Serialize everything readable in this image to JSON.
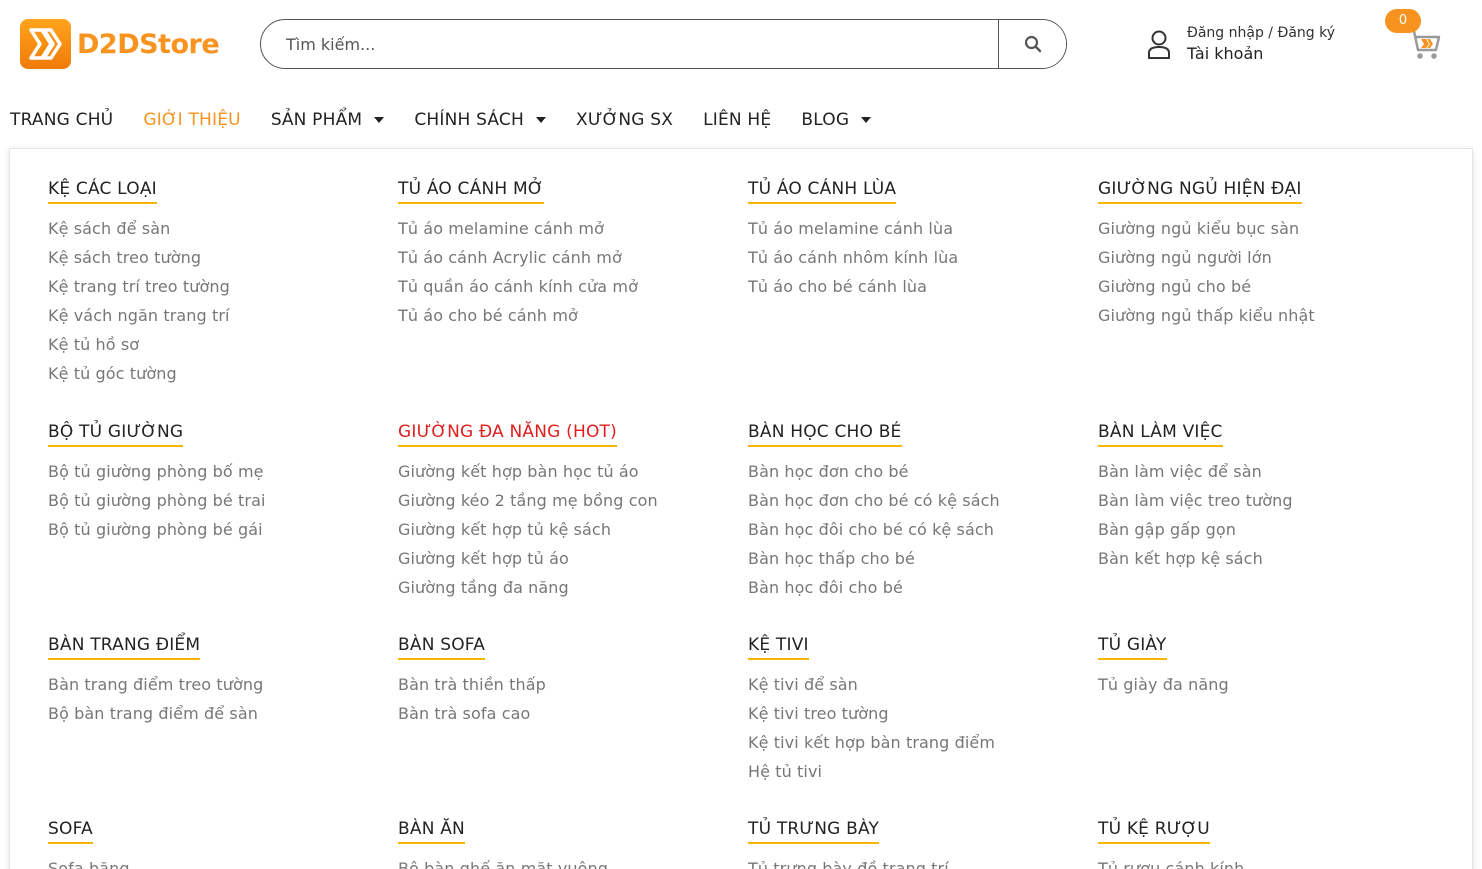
{
  "header": {
    "logo_text": "D2DStore",
    "search_placeholder": "Tìm kiếm...",
    "account_line1": "Đăng nhập / Đăng ký",
    "account_line2": "Tài khoản",
    "cart_count": "0"
  },
  "nav": {
    "items": [
      {
        "label": "TRANG CHỦ",
        "dropdown": false,
        "active": false
      },
      {
        "label": "GIỚI THIỆU",
        "dropdown": false,
        "active": true
      },
      {
        "label": "SẢN PHẨM",
        "dropdown": true,
        "active": false
      },
      {
        "label": "CHÍNH SÁCH",
        "dropdown": true,
        "active": false
      },
      {
        "label": "XƯỞNG SX",
        "dropdown": false,
        "active": false
      },
      {
        "label": "LIÊN HỆ",
        "dropdown": false,
        "active": false
      },
      {
        "label": "BLOG",
        "dropdown": true,
        "active": false
      }
    ]
  },
  "colors": {
    "brand": "#f7931e",
    "underline": "#f7b500",
    "hot": "#e01e1e",
    "link": "#777777"
  },
  "mega_menu": {
    "rows": [
      [
        {
          "title": "KỆ CÁC LOẠI",
          "items": [
            "Kệ sách để sàn",
            "Kệ sách treo tường",
            "Kệ trang trí treo tường",
            "Kệ vách ngăn trang trí",
            "Kệ tủ hồ sơ",
            "Kệ tủ góc tường"
          ]
        },
        {
          "title": "TỦ ÁO CÁNH MỞ",
          "items": [
            "Tủ áo melamine cánh mở",
            "Tủ áo cánh Acrylic cánh mở",
            "Tủ quần áo cánh kính cửa mở",
            "Tủ áo cho bé cánh mở"
          ]
        },
        {
          "title": "TỦ ÁO CÁNH LÙA",
          "items": [
            "Tủ áo melamine cánh lùa",
            "Tủ áo cánh nhôm kính lùa",
            "Tủ áo cho bé cánh lùa"
          ]
        },
        {
          "title": "GIƯỜNG NGỦ HIỆN ĐẠI",
          "items": [
            "Giường ngủ kiểu bục sàn",
            "Giường ngủ người lớn",
            "Giường ngủ cho bé",
            "Giường ngủ thấp kiểu nhật"
          ]
        }
      ],
      [
        {
          "title": "BỘ TỦ GIƯỜNG",
          "items": [
            "Bộ tủ giường phòng bố mẹ",
            "Bộ tủ giường phòng bé trai",
            "Bộ tủ giường phòng bé gái"
          ]
        },
        {
          "title": "GIƯỜNG ĐA NĂNG (HOT)",
          "hot": true,
          "items": [
            "Giường kết hợp bàn học tủ áo",
            "Giường kéo 2 tầng mẹ bồng con",
            "Giường kết hợp tủ kệ sách",
            "Giường kết hợp tủ áo",
            "Giường tầng đa năng"
          ]
        },
        {
          "title": "BÀN HỌC CHO BÉ",
          "items": [
            "Bàn học đơn cho bé",
            "Bàn học đơn cho bé có kệ sách",
            "Bàn học đôi cho bé có kệ sách",
            "Bàn học thấp cho bé",
            "Bàn học đôi cho bé"
          ]
        },
        {
          "title": "BÀN LÀM VIỆC",
          "items": [
            "Bàn làm việc để sàn",
            "Bàn làm việc treo tường",
            "Bàn gập gấp gọn",
            "Bàn kết hợp kệ sách"
          ]
        }
      ],
      [
        {
          "title": "BÀN TRANG ĐIỂM",
          "items": [
            "Bàn trang điểm treo tường",
            "Bộ bàn trang điểm để sàn"
          ]
        },
        {
          "title": "BÀN SOFA",
          "items": [
            "Bàn trà thiền thấp",
            "Bàn trà sofa cao"
          ]
        },
        {
          "title": "KỆ TIVI",
          "items": [
            "Kệ tivi để sàn",
            "Kệ tivi treo tường",
            "Kệ tivi kết hợp bàn trang điểm",
            "Hệ tủ tivi"
          ]
        },
        {
          "title": "TỦ GIÀY",
          "items": [
            "Tủ giày đa năng"
          ]
        }
      ],
      [
        {
          "title": "SOFA",
          "items": [
            "Sofa băng"
          ]
        },
        {
          "title": "BÀN ĂN",
          "items": [
            "Bộ bàn ghế ăn mặt vuông"
          ]
        },
        {
          "title": "TỦ TRƯNG BÀY",
          "items": [
            "Tủ trưng bày đồ trang trí"
          ]
        },
        {
          "title": "TỦ KỆ RƯỢU",
          "items": [
            "Tủ rượu cánh kính"
          ]
        }
      ]
    ]
  }
}
